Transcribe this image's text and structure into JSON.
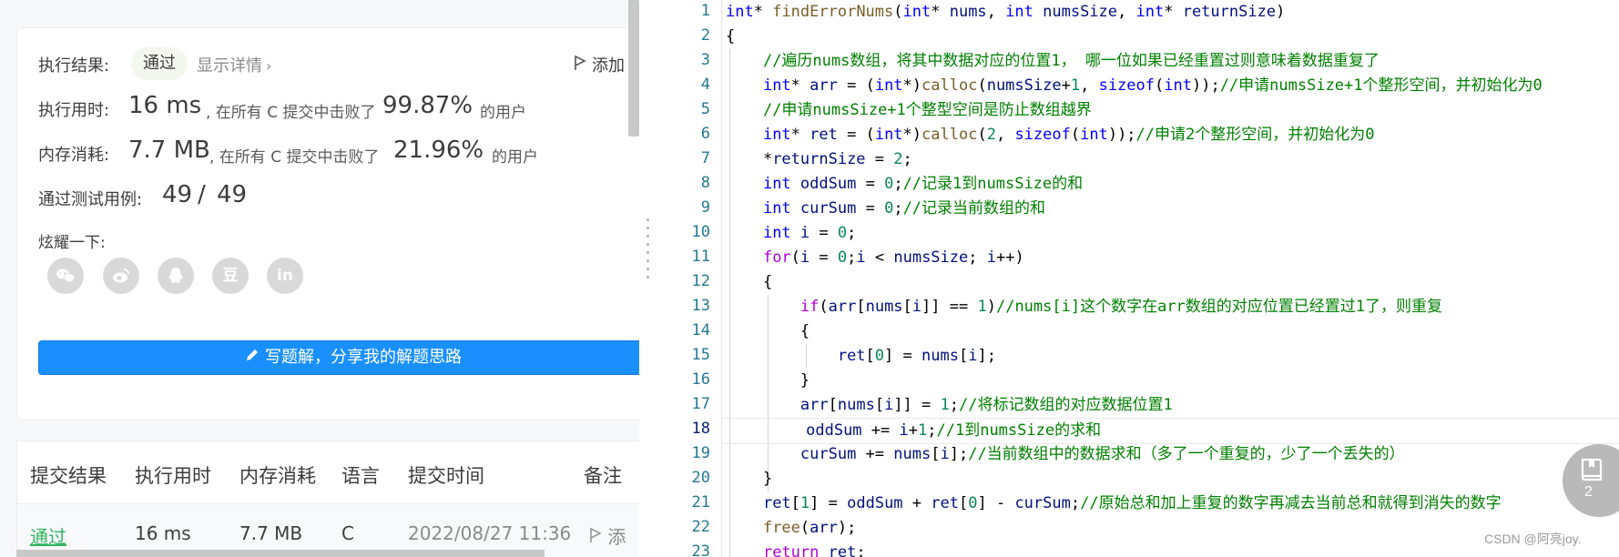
{
  "result": {
    "label": "执行结果:",
    "status": "通过",
    "details_link": "显示详情",
    "add_note": "添加"
  },
  "runtime": {
    "label": "执行用时:",
    "value": "16 ms",
    "beat_text": ", 在所有 C 提交中击败了",
    "percent": "99.87%",
    "suffix": "的用户"
  },
  "memory": {
    "label": "内存消耗:",
    "value": "7.7 MB",
    "beat_text": ", 在所有 C 提交中击败了",
    "percent": "21.96%",
    "suffix": "的用户"
  },
  "tests": {
    "label": "通过测试用例:",
    "passed": "49",
    "sep": "/",
    "total": "49"
  },
  "share": {
    "label": "炫耀一下:",
    "icons": [
      "wechat-icon",
      "weibo-icon",
      "qq-icon",
      "douban-icon",
      "linkedin-icon"
    ],
    "douban_glyph": "豆",
    "linkedin_glyph": "in"
  },
  "write_solution_button": "写题解，分享我的解题思路",
  "table": {
    "headers": [
      "提交结果",
      "执行用时",
      "内存消耗",
      "语言",
      "提交时间",
      "备注"
    ],
    "row": {
      "result": "通过",
      "runtime": "16 ms",
      "memory": "7.7 MB",
      "language": "C",
      "time": "2022/08/27 11:36",
      "note": "添"
    }
  },
  "editor": {
    "line_numbers": [
      "1",
      "2",
      "3",
      "4",
      "5",
      "6",
      "7",
      "8",
      "9",
      "10",
      "11",
      "12",
      "13",
      "14",
      "15",
      "16",
      "17",
      "18",
      "19",
      "20",
      "21",
      "22",
      "23"
    ],
    "current_line": 18
  },
  "notes_badge": {
    "count": "2"
  },
  "watermark": "CSDN @阿亮joy.",
  "colors": {
    "pass_green": "#2db55d",
    "primary_blue": "#1a90ff",
    "keyword": "#0000ff",
    "control": "#af00db",
    "number": "#098658",
    "comment": "#008000",
    "function": "#795e26",
    "variable": "#001080",
    "line_number": "#237893"
  }
}
